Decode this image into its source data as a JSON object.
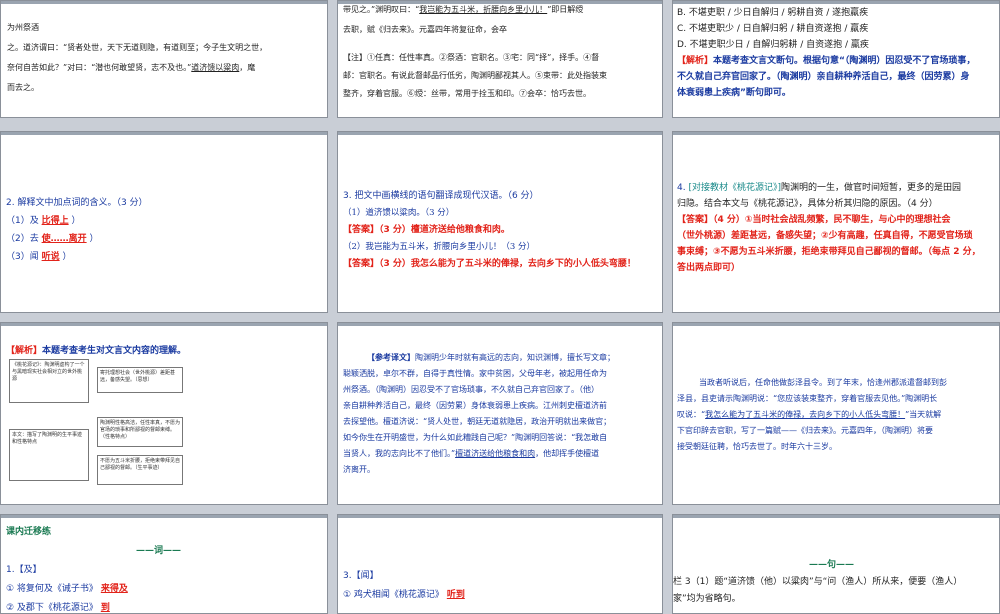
{
  "s1": {
    "l1": "为州祭酒",
    "l2": "之。道济谓曰：“贤者处世，天下无道则隐，有道则至；今子生文明之世，",
    "l3a": "奈何自苦如此？”对曰：“潜也何敢望贤，志不及也。”",
    "l3b": "道济馈以粱肉",
    "l3c": "，麾",
    "l4": "而去之。"
  },
  "s2": {
    "l1a": "带见之。”渊明叹曰：“",
    "l1b": "我岂能为五斗米，折腰向乡里小儿！",
    "l1c": "”即日解绶",
    "l2": "去职，赋《归去来》。元嘉四年将复征命，会卒",
    "n1": "【注】①任真：任性率真。②祭酒：官职名。③宅：同“择”，择手。④督",
    "n2": "邮：官职名。有说此督邮品行低劣，陶渊明鄙视其人。⑤束带：此处指装束",
    "n3": "整齐，穿着官服。⑥绶：丝带，常用于拴玉和印。⑦会卒：恰巧去世。"
  },
  "s3": {
    "o1": "B. 不堪吏职 / 少日自解归 / 躬耕自资 / 遂抱羸疾",
    "o2": "C. 不堪吏职少 / 日自解归躬 / 耕自资遂抱 / 羸疾",
    "o3": "D. 不堪吏职少日 / 自解归躬耕 / 自资遂抱 / 羸疾",
    "jx_tag": "【解析】",
    "jx1": "本题考查文言文断句。根据句意“（陶渊明）因忍受不了官场琐事，",
    "jx2": "不久就自己弃官回家了。（陶渊明）亲自耕种养活自己，最终（因劳累）身",
    "jx3": "体衰弱患上疾病”断句即可。"
  },
  "s4": {
    "q": "2. 解释文中加点词的含义。（3 分）",
    "i1a": "（1）及 ",
    "i1b": "比得上",
    "i2a": "（2）去 ",
    "i2b": "使……离开",
    "i3a": "（3）闻 ",
    "i3b": "听说"
  },
  "s5": {
    "q": "3. 把文中画横线的语句翻译成现代汉语。（6 分）",
    "a1": "（1）道济馈以粱肉。（3 分）",
    "a1ans_tag": "【答案】",
    "a1ans": "（3 分）檀道济送给他粮食和肉。",
    "a2": "（2）我岂能为五斗米，折腰向乡里小儿！（3 分）",
    "a2ans_tag": "【答案】",
    "a2ans": "（3 分）我怎么能为了五斗米的俸禄，去向乡下的小人低头弯腰！"
  },
  "s6": {
    "q1a": "4. ",
    "q1b": "[对接教材《桃花源记》]",
    "q1c": "陶渊明的一生，做官时间短暂，更多的是田园",
    "q2": "归隐。结合本文与《桃花源记》，具体分析其归隐的原因。（4 分）",
    "ans_tag": "【答案】",
    "a1": "（4 分）①当时社会战乱频繁，民不聊生，与心中的理想社会",
    "a2": "（世外桃源）差距甚远，备感失望；②少有高趣，任真自得，不愿受官场琐",
    "a3": "事束缚；③不愿为五斗米折腰，拒绝束带拜见自己鄙视的督邮。（每点 2 分，",
    "a4": "答出两点即可）"
  },
  "s7": {
    "tag": "【解析】",
    "txt": "本题考查考生对文言文内容的理解。",
    "b1": "《桃花源记》：陶渊明虚构了一个与黑暗现实社会相对立的世外桃源",
    "b2": "寄托理想社会（世外桃源）差距甚远，备感失望。（思想）",
    "b3": "本文：描写了陶渊明的生平事迹和性格特点",
    "b4": "陶渊明性格高洁，任性率真，不愿为官场的琐事和所鄙视的督邮束缚。（性格特点）",
    "b5": "不愿为五斗米折腰，拒绝束带拜见自己鄙视的督邮。（生平事迹）"
  },
  "s8": {
    "title": "【参考译文】",
    "l1": "陶渊明少年时就有高远的志向，知识渊博，擅长写文章；",
    "l2": "聪颖洒脱，卓尔不群，自得于真性情。家中贫困，父母年老，被起用任命为",
    "l3": "州祭酒。（陶渊明）因忍受不了官场琐事，不久就自己弃官回家了。（他）",
    "l4": "亲自耕种养活自己，最终（因劳累）身体衰弱患上疾病。江州刺史檀道济前",
    "l5": "去探望他。檀道济说：“贤人处世，朝廷无道就隐居，政治开明就出来做官；",
    "l6": "如今你生在开明盛世，为什么如此糟践自己呢？”陶渊明回答说：“我怎敢自",
    "l7a": "当贤人，我的志向比不了他们。”",
    "l7b": "檀道济送给他粮食和肉",
    "l7c": "，他却挥手使檀道",
    "l8": "济离开。"
  },
  "s9": {
    "l1": "当政者听说后，任命他做彭泽县令。到了年末，恰逢州郡派遣督邮到彭",
    "l2": "泽县，县吏请示陶渊明说：“您应该装束整齐，穿着官服去见他。”陶渊明长",
    "l3a": "叹说：“",
    "l3b": "我怎么能为了五斗米的俸禄，去向乡下的小人低头弯腰！",
    "l3c": "”当天就解",
    "l4": "下官印辞去官职，写了一篇赋——《归去来》。元嘉四年，（陶渊明）将要",
    "l5": "接受朝廷征聘，恰巧去世了。时年六十三岁。"
  },
  "s10": {
    "title": "课内迁移练",
    "sub": "——词——",
    "h1": "1.【及】",
    "i1a": "① 将复何及《诫子书》",
    "i1b": "来得及",
    "i2a": "② 及郡下《桃花源记》",
    "i2b": "到"
  },
  "s11": {
    "h": "3.【闻】",
    "i1a": "① 鸡犬相闻《桃花源记》",
    "i1b": "听到"
  },
  "s12": {
    "sub": "——句——",
    "t1a": "栏 3（1）题“道济馈（他）以粱肉”与“问（渔人）所从来，便要（渔人）",
    "t2": "家”均为省略句。"
  }
}
